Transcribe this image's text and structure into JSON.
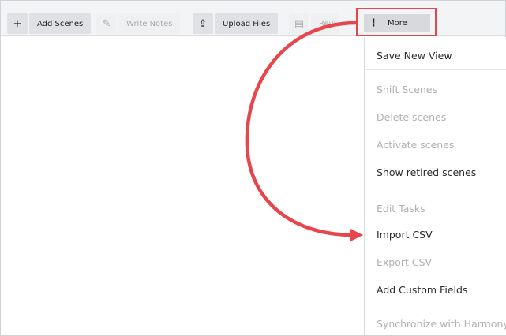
{
  "toolbar": {
    "add_scenes": {
      "icon": "+",
      "label": "Add Scenes"
    },
    "write_notes": {
      "icon": "✎",
      "label": "Write Notes"
    },
    "upload_files": {
      "icon": "⇪",
      "label": "Upload Files"
    },
    "review": {
      "icon": "▤",
      "label": "Revi"
    },
    "more": {
      "icon": "⋮",
      "label": "More"
    }
  },
  "menu": {
    "items": [
      {
        "label": "Save New View",
        "enabled": true
      },
      {
        "label": "Shift Scenes",
        "enabled": false
      },
      {
        "label": "Delete scenes",
        "enabled": false
      },
      {
        "label": "Activate scenes",
        "enabled": false
      },
      {
        "label": "Show retired scenes",
        "enabled": true
      },
      {
        "label": "Edit Tasks",
        "enabled": false
      },
      {
        "label": "Import CSV",
        "enabled": true
      },
      {
        "label": "Export CSV",
        "enabled": false
      },
      {
        "label": "Add Custom Fields",
        "enabled": true
      },
      {
        "label": "Synchronize with Harmony",
        "enabled": false
      }
    ]
  },
  "colors": {
    "highlight": "#e8464d",
    "toolbar_bg": "#f3f4f5",
    "enabled_button": "#dfe1e4",
    "disabled_text": "#b1b1b1"
  }
}
